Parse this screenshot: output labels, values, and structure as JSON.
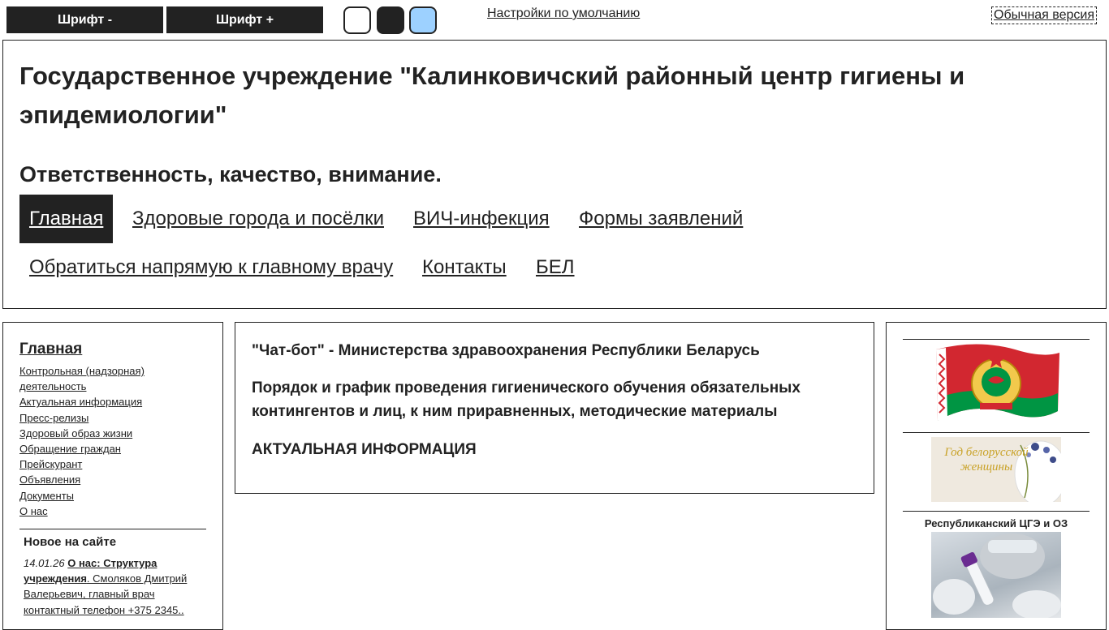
{
  "toolbar": {
    "font_decrease_label": "Шрифт -",
    "font_increase_label": "Шрифт +",
    "color_schemes": [
      "white",
      "black",
      "blue"
    ],
    "reset_label": "Настройки по умолчанию",
    "normal_version_label": "Обычная версия"
  },
  "header": {
    "title": "Государственное учреждение \"Калинковичский районный центр гигиены и эпидемиологии\"",
    "slogan": "Ответственность, качество, внимание."
  },
  "nav": {
    "items": [
      {
        "label": "Главная",
        "active": true
      },
      {
        "label": "Здоровые города и посёлки"
      },
      {
        "label": "ВИЧ-инфекция"
      },
      {
        "label": "Формы заявлений"
      },
      {
        "label": "Обратиться напрямую к главному врачу"
      },
      {
        "label": "Контакты"
      },
      {
        "label": "БЕЛ"
      }
    ]
  },
  "sidebar": {
    "title": "Главная",
    "menu": [
      "Контрольная (надзорная) деятельность",
      "Актуальная информация",
      "Пресс-релизы",
      "Здоровый образ жизни",
      "Обращение граждан",
      "Прейскурант",
      "Объявления",
      "Документы",
      "О нас"
    ],
    "news_heading": "Новое на сайте",
    "news": [
      {
        "date": "14.01.26",
        "link": "О нас: Структура учреждения",
        "text": ". Смоляков Дмитрий Валерьевич, главный врач контактный телефон +375 2345.."
      }
    ]
  },
  "content": {
    "links": [
      "\"Чат-бот\" - Министерства здравоохранения Республики Беларусь",
      "Порядок и график проведения гигиенического обучения обязательных контингентов и лиц, к ним приравненных, методические материалы",
      "АКТУАЛЬНАЯ ИНФОРМАЦИЯ"
    ]
  },
  "right": {
    "banner2_text": "Год белорусской женщины",
    "banner3_caption": "Республиканский ЦГЭ и ОЗ"
  },
  "colors": {
    "text": "#222222",
    "flag_red": "#d22730",
    "flag_green": "#009543",
    "scheme_blue": "#9dd1ff"
  }
}
